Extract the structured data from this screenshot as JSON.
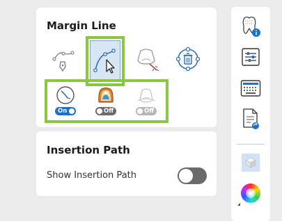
{
  "margin_line": {
    "title": "Margin Line",
    "tools": [
      {
        "name": "margin-point-tool",
        "selected": false
      },
      {
        "name": "margin-curve-select-tool",
        "selected": true
      },
      {
        "name": "hat-wand-tool",
        "selected": false
      },
      {
        "name": "delete-points-tool",
        "selected": false
      }
    ],
    "modes": [
      {
        "name": "margin-mode-1",
        "toggle_label": "On",
        "state": "on"
      },
      {
        "name": "margin-mode-2",
        "toggle_label": "Off",
        "state": "off"
      },
      {
        "name": "margin-mode-3",
        "toggle_label": "Off",
        "state": "off",
        "disabled": true
      }
    ]
  },
  "insertion_path": {
    "title": "Insertion Path",
    "show_label": "Show Insertion Path",
    "show_enabled": false
  },
  "sidebar": {
    "items": [
      "tooth-info-icon",
      "sliders-icon",
      "keyboard-icon",
      "document-sync-icon",
      "cube-view-icon",
      "color-wheel-icon"
    ]
  },
  "colors": {
    "accent_blue": "#1a6fd1",
    "highlight_green": "#8cc63f",
    "toggle_off": "#6a6a6a"
  }
}
